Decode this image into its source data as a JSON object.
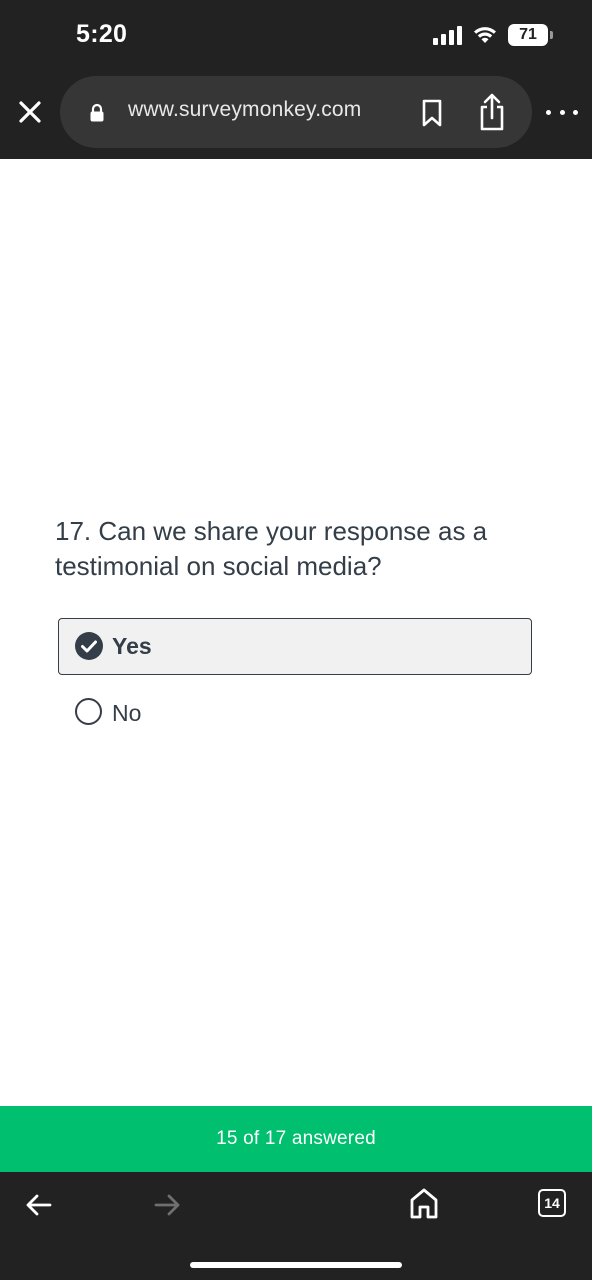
{
  "status_bar": {
    "time": "5:20",
    "battery_level": "71",
    "icons": [
      "signal-icon",
      "wifi-icon",
      "battery-icon"
    ]
  },
  "browser": {
    "url": "www.surveymonkey.com",
    "icons": [
      "close-icon",
      "lock-icon",
      "bookmark-icon",
      "share-icon",
      "more-icon"
    ]
  },
  "question": {
    "title": "17. Can we share your response as a testimonial on social media?",
    "options": [
      {
        "label": "Yes",
        "selected": true
      },
      {
        "label": "No",
        "selected": false
      }
    ]
  },
  "progress": {
    "text": "15 of 17 answered",
    "answered": 15,
    "total": 17
  },
  "toolbar": {
    "tab_count": "14",
    "icons": [
      "back-arrow-icon",
      "forward-arrow-icon",
      "home-icon",
      "tabs-icon"
    ]
  },
  "colors": {
    "accent_green": "#00bf6f",
    "browser_chrome": "#222222",
    "text": "#333e48"
  }
}
